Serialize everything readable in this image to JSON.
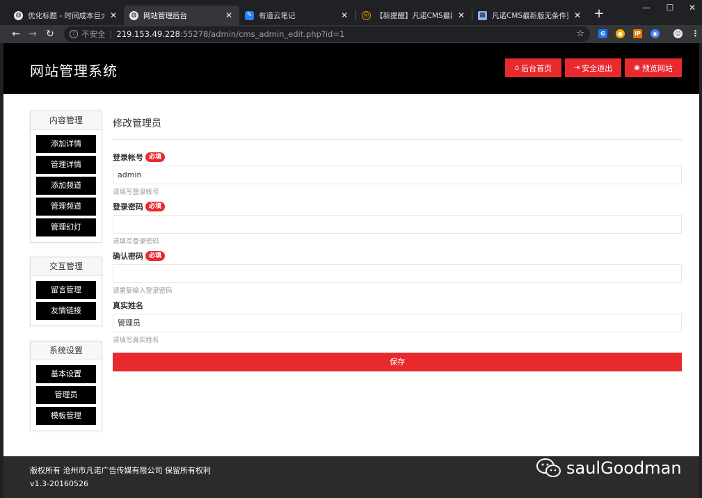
{
  "browser": {
    "tabs": [
      {
        "title": "优化标题 - 时间成本巨大 - 月",
        "icon": "globe-icon"
      },
      {
        "title": "网站管理后台",
        "icon": "globe-icon"
      },
      {
        "title": "有道云笔记",
        "icon": "note-icon"
      },
      {
        "title": "【新提醒】凡诺CMS最新版",
        "icon": "bug-icon"
      },
      {
        "title": "凡诺CMS最新版无条件更改",
        "icon": "image-icon"
      }
    ],
    "close_glyph": "✕",
    "new_tab_glyph": "+",
    "window_controls": {
      "minimize": "—",
      "maximize": "☐",
      "close": "✕"
    },
    "address": {
      "security": "不安全",
      "host": "219.153.49.228",
      "rest": ":55278/admin/cms_admin_edit.php?id=1"
    }
  },
  "site": {
    "title": "网站管理系统",
    "header_buttons": [
      {
        "label": "后台首页",
        "icon": "home-icon"
      },
      {
        "label": "安全退出",
        "icon": "logout-icon"
      },
      {
        "label": "预览网站",
        "icon": "eye-icon"
      }
    ]
  },
  "sidebar": {
    "sections": [
      {
        "title": "内容管理",
        "items": [
          "添加详情",
          "管理详情",
          "添加频道",
          "管理频道",
          "管理幻灯"
        ]
      },
      {
        "title": "交互管理",
        "items": [
          "留言管理",
          "友情链接"
        ]
      },
      {
        "title": "系统设置",
        "items": [
          "基本设置",
          "管理员",
          "模板管理"
        ]
      }
    ]
  },
  "form": {
    "title": "修改管理员",
    "required_badge": "必填",
    "fields": [
      {
        "label": "登录帐号",
        "required": true,
        "value": "admin",
        "hint": "请填写登录帐号"
      },
      {
        "label": "登录密码",
        "required": true,
        "value": "",
        "hint": "请填写登录密码"
      },
      {
        "label": "确认密码",
        "required": true,
        "value": "",
        "hint": "请重复输入登录密码"
      },
      {
        "label": "真实姓名",
        "required": false,
        "value": "管理员",
        "hint": "请填写真实姓名"
      }
    ],
    "save_label": "保存"
  },
  "footer": {
    "copyright": "版权所有 沧州市凡诺广告传媒有限公司 保留所有权利",
    "version": "v1.3-20160526"
  },
  "watermark": {
    "text": "saulGoodman",
    "icon": "wechat-icon"
  },
  "colors": {
    "accent": "#e8292e",
    "header_bg": "#000000",
    "footer_bg": "#2b2b2b"
  }
}
